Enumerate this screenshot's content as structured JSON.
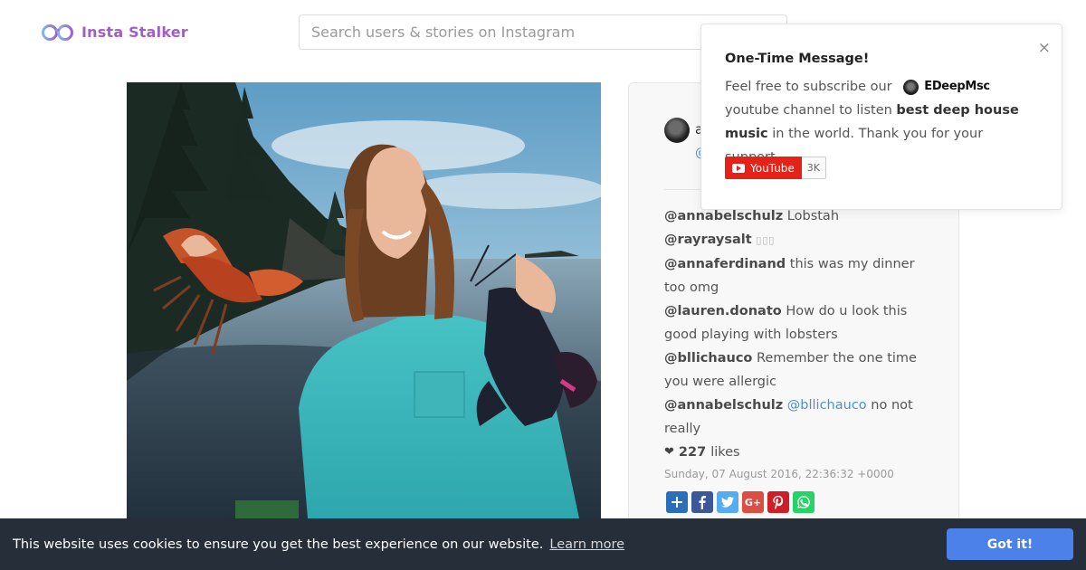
{
  "header": {
    "logo_text": "Insta Stalker",
    "search_placeholder": "Search users & stories on Instagram"
  },
  "post": {
    "owner_name": "a",
    "owner_handle": "@",
    "comments": [
      {
        "user": "@annabelschulz",
        "text": "Lobstah"
      },
      {
        "user": "@rayraysalt",
        "text": "▯▯▯"
      },
      {
        "user": "@annaferdinand",
        "text": "this was my dinner too omg"
      },
      {
        "user": "@lauren.donato",
        "text": "How do u look this good playing with lobsters"
      },
      {
        "user": "@bllichauco",
        "text": "Remember the one time you were allergic"
      },
      {
        "user": "@annabelschulz",
        "mention": "@bllichauco",
        "text": "no not really"
      }
    ],
    "likes_count": "227",
    "likes_label": "likes",
    "date": "Sunday, 07 August 2016, 22:36:32 +0000",
    "share_icons": [
      "addthis-icon",
      "facebook-icon",
      "twitter-icon",
      "google-plus-icon",
      "pinterest-icon",
      "whatsapp-icon"
    ],
    "share_colors": {
      "addthis": "#2a6ebb",
      "facebook": "#3b5998",
      "twitter": "#55acee",
      "google_plus": "#dc4e41",
      "pinterest": "#cb2027",
      "whatsapp": "#25d366"
    }
  },
  "popup": {
    "close": "×",
    "title": "One-Time Message!",
    "text_before": "Feel free to subscribe our",
    "brand_name": "EDeepMsc",
    "text_after": "youtube channel to listen",
    "highlight": "best deep house music",
    "text_end": "in the world. Thank you for your support.",
    "youtube_label": "YouTube",
    "youtube_count": "3K"
  },
  "cookie": {
    "message": "This website uses cookies to ensure you get the best experience on our website.",
    "link": "Learn more",
    "button": "Got it!"
  },
  "colors": {
    "logo": "#a15fc4",
    "link": "#4a90d9",
    "cookie_bg": "#252e39",
    "cookie_button": "#4b81e8",
    "youtube_red": "#e62117"
  }
}
